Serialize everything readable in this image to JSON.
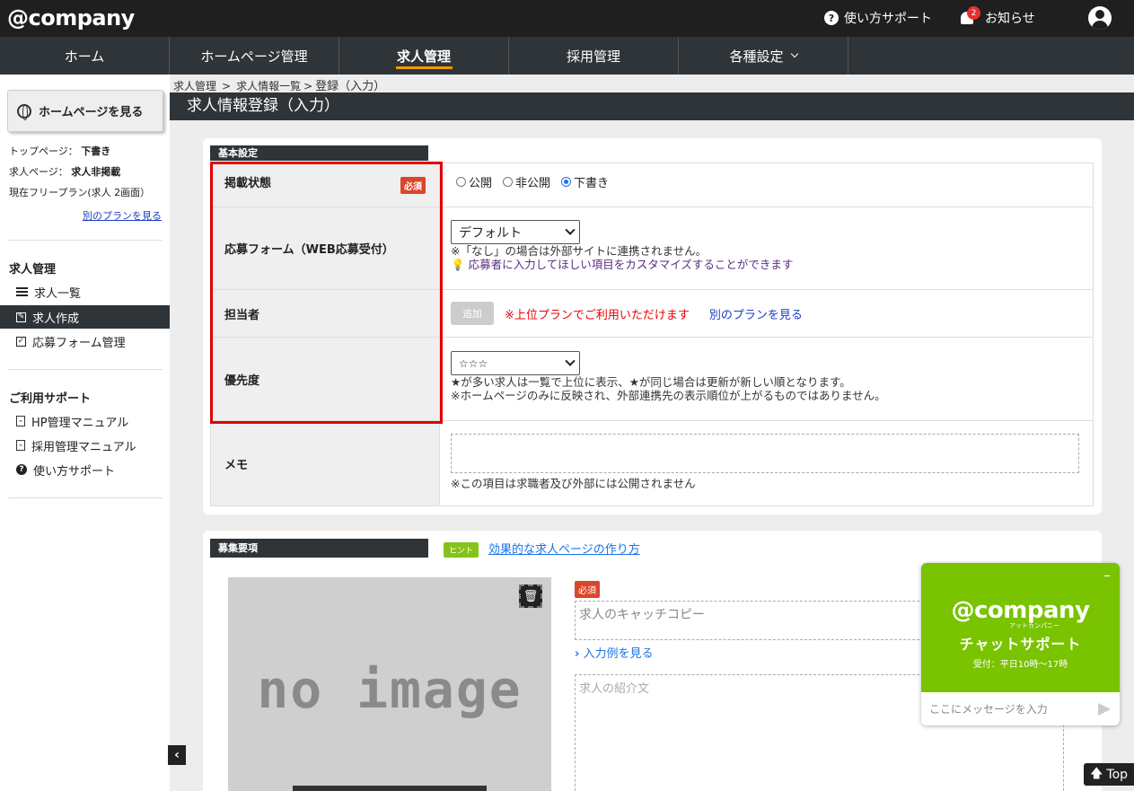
{
  "header": {
    "logo_text": "@company",
    "help_label": "使い方サポート",
    "notification_label": "お知らせ",
    "notification_count": "2"
  },
  "nav": {
    "items": [
      "ホーム",
      "ホームページ管理",
      "求人管理",
      "採用管理",
      "各種設定"
    ],
    "active_index": 2
  },
  "sidebar": {
    "hp_button": "ホームページを見る",
    "top_page_label": "トップページ：",
    "top_page_value": "下書き",
    "job_page_label": "求人ページ：",
    "job_page_value": "求人非掲載",
    "plan_text": "現在フリープラン(求人 2画面）",
    "other_plan_link": "別のプランを見る",
    "job_section_title": "求人管理",
    "job_items": [
      "求人一覧",
      "求人作成",
      "応募フォーム管理"
    ],
    "active_job_item": "求人作成",
    "support_section_title": "ご利用サポート",
    "support_items": [
      "HP管理マニュアル",
      "採用管理マニュアル",
      "使い方サポート"
    ]
  },
  "breadcrumb": [
    "求人管理",
    "求人情報一覧",
    "登録（入力）"
  ],
  "page_title": "求人情報登録（入力）",
  "basic_settings": {
    "section_title": "基本設定",
    "required_badge": "必須",
    "status": {
      "label": "掲載状態",
      "options": [
        "公開",
        "非公開",
        "下書き"
      ],
      "selected": "下書き"
    },
    "form": {
      "label": "応募フォーム（WEB応募受付）",
      "value": "デフォルト",
      "note": "※「なし」の場合は外部サイトに連携されません。",
      "hint": "応募者に入力してほしい項目をカスタマイズすることができます"
    },
    "assignee": {
      "label": "担当者",
      "add_button": "追加",
      "upgrade_note": "※上位プランでご利用いただけます",
      "plan_link": "別のプランを見る"
    },
    "priority": {
      "label": "優先度",
      "value": "☆☆☆",
      "note1": "★が多い求人は一覧で上位に表示、★が同じ場合は更新が新しい順となります。",
      "note2": "※ホームページのみに反映され、外部連携先の表示順位が上がるものではありません。"
    },
    "memo": {
      "label": "メモ",
      "note": "※この項目は求職者及び外部には公開されません"
    }
  },
  "recruitment": {
    "section_title": "募集要項",
    "hint_badge": "ヒント",
    "hint_link": "効果的な求人ページの作り方",
    "no_image": "no image",
    "required_badge": "必須",
    "catch_copy_placeholder": "求人のキャッチコピー",
    "example_link": "入力例を見る",
    "intro_placeholder": "求人の紹介文"
  },
  "chat": {
    "logo": "@company",
    "kana": "アットカンパニー",
    "title": "チャットサポート",
    "hours": "受付：平日10時〜17時",
    "input_placeholder": "ここにメッセージを入力"
  },
  "top_button": "Top"
}
